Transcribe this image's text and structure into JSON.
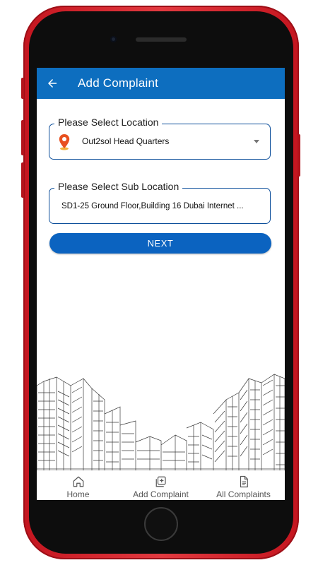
{
  "appbar": {
    "title": "Add Complaint",
    "back_icon": "arrow-left-icon"
  },
  "location": {
    "label": "Please Select Location",
    "value": "Out2sol Head Quarters",
    "icon": "location-pin-icon"
  },
  "sub_location": {
    "label": "Please Select Sub Location",
    "value": "SD1-25 Ground Floor,Building 16 Dubai Internet ..."
  },
  "next_button": {
    "label": "NEXT"
  },
  "bottom_nav": {
    "items": [
      {
        "label": "Home",
        "icon": "home-icon"
      },
      {
        "label": "Add Complaint",
        "icon": "add-complaint-icon"
      },
      {
        "label": "All Complaints",
        "icon": "document-icon"
      }
    ]
  },
  "colors": {
    "appbar": "#0d6ebf",
    "button": "#0b63c0",
    "frame": "#d0202a",
    "border": "#0d4f9b"
  }
}
